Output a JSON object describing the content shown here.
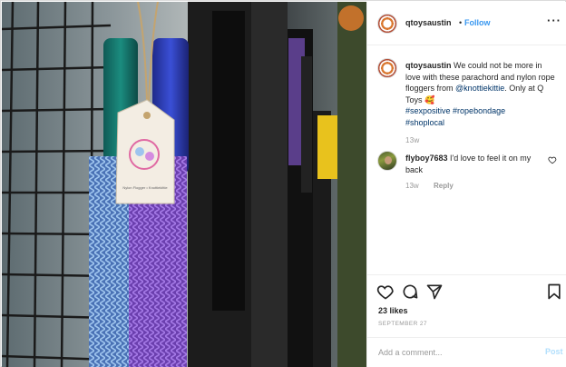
{
  "header": {
    "username": "qtoysaustin",
    "separator": "•",
    "follow_label": "Follow",
    "more_label": "···"
  },
  "caption": {
    "username": "qtoysaustin",
    "text_1": "We could not be more in love with these parachord and nylon rope floggers from",
    "mention": "@knottiekittie",
    "text_2": ". Only at Q Toys",
    "emoji": "🥰",
    "hashtags": [
      "#sexpositive",
      "#ropebondage",
      "#shoplocal"
    ],
    "time": "13w"
  },
  "comment": {
    "username": "flyboy7683",
    "text": "I'd love to feel it on my back",
    "time": "13w",
    "reply_label": "Reply"
  },
  "actions": {
    "likes": "23 likes",
    "date": "SEPTEMBER 27"
  },
  "add_comment": {
    "placeholder": "Add a comment...",
    "post_label": "Post"
  },
  "photo": {
    "tag_text": "Nylon Flogger • Knottiekittie"
  },
  "icons": {
    "like": "heart-icon",
    "comment": "comment-icon",
    "share": "share-icon",
    "save": "bookmark-icon",
    "more": "more-options-icon"
  },
  "colors": {
    "link_blue": "#3897f0",
    "mention_blue": "#003569",
    "muted_gray": "#999999",
    "post_disabled": "#b2dffc"
  }
}
